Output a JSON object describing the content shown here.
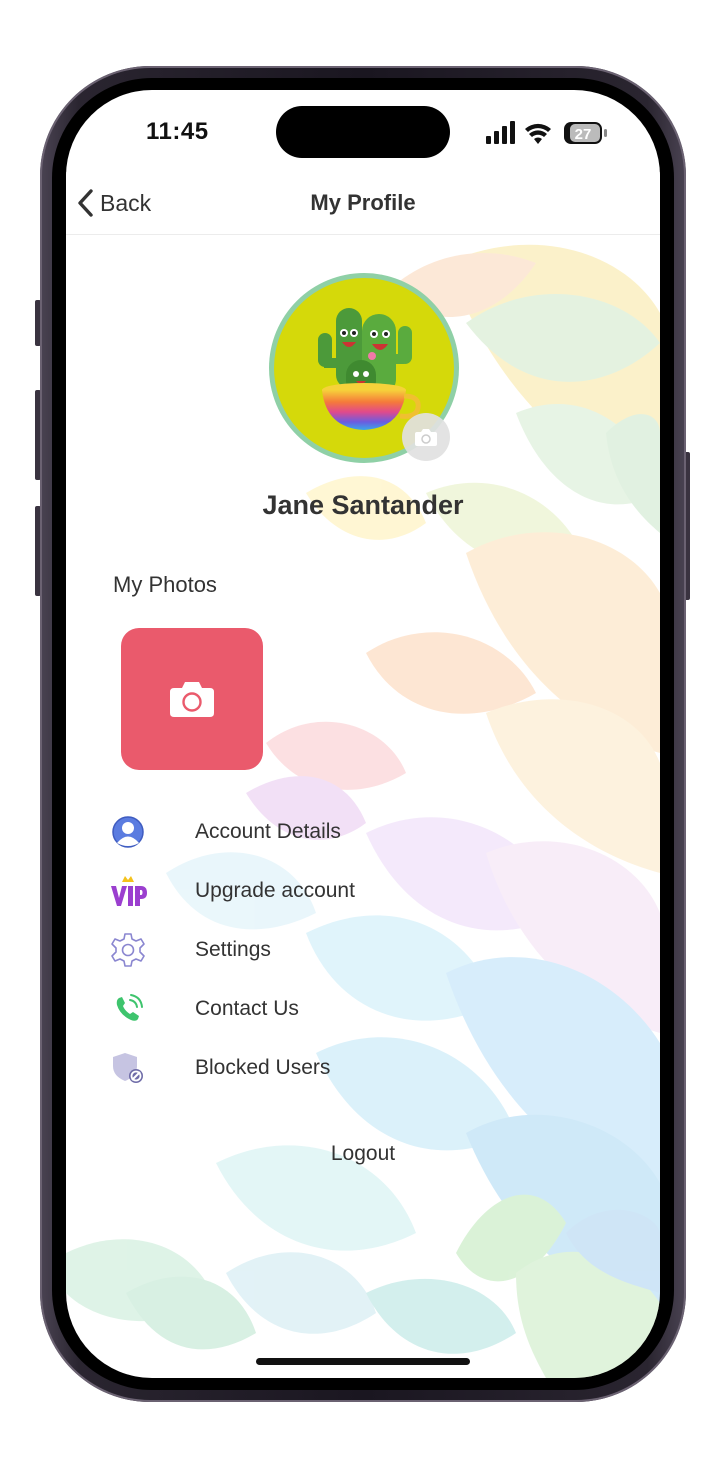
{
  "status_bar": {
    "time": "11:45",
    "battery": "27"
  },
  "navbar": {
    "back_label": "Back",
    "title": "My Profile"
  },
  "profile": {
    "name": "Jane Santander"
  },
  "photos": {
    "label": "My Photos"
  },
  "menu": {
    "items": [
      {
        "label": "Account Details",
        "icon": "user-icon"
      },
      {
        "label": "Upgrade account",
        "icon": "vip-icon"
      },
      {
        "label": "Settings",
        "icon": "gear-icon"
      },
      {
        "label": "Contact Us",
        "icon": "phone-icon"
      },
      {
        "label": "Blocked Users",
        "icon": "shield-block-icon"
      }
    ]
  },
  "logout_label": "Logout",
  "colors": {
    "add_photo": "#ea5a6c",
    "avatar_bg": "#d5d90a",
    "avatar_ring": "#8fd0a6",
    "user_icon": "#5b7ce0",
    "vip_icon": "#9b3fcf",
    "phone_icon": "#3ec46d"
  }
}
